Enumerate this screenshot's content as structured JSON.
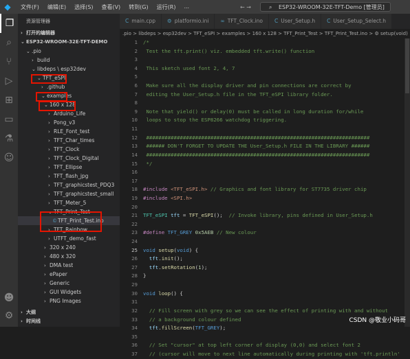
{
  "titlebar": {
    "menus": [
      "文件(F)",
      "编辑(E)",
      "选择(S)",
      "查看(V)",
      "转到(G)",
      "运行(R)",
      "..."
    ],
    "search_text": "ESP32-WROOM-32E-TFT-Demo [管理员]"
  },
  "sidebar": {
    "title": "资源管理器",
    "rows": [
      {
        "label": "打开的编辑器",
        "indent": 0,
        "chev": "›",
        "bold": true
      },
      {
        "label": "ESP32-WROOM-32E-TFT-DEMO",
        "indent": 0,
        "chev": "⌄",
        "bold": true
      },
      {
        "label": ".pio",
        "indent": 1,
        "chev": "⌄"
      },
      {
        "label": "build",
        "indent": 2,
        "chev": "›"
      },
      {
        "label": "libdeps \\ esp32dev",
        "indent": 2,
        "chev": "⌄"
      },
      {
        "label": "TFT_eSPI",
        "indent": 3,
        "chev": "⌄"
      },
      {
        "label": ".github",
        "indent": 4,
        "chev": "›"
      },
      {
        "label": "examples",
        "indent": 4,
        "chev": "⌄"
      },
      {
        "label": "160 x 128",
        "indent": 5,
        "chev": "⌄"
      },
      {
        "label": "Arduino_Life",
        "indent": 6,
        "chev": "›"
      },
      {
        "label": "Pong_v3",
        "indent": 6,
        "chev": "›"
      },
      {
        "label": "RLE_Font_test",
        "indent": 6,
        "chev": "›"
      },
      {
        "label": "TFT_Char_times",
        "indent": 6,
        "chev": "›"
      },
      {
        "label": "TFT_Clock",
        "indent": 6,
        "chev": "›"
      },
      {
        "label": "TFT_Clock_Digital",
        "indent": 6,
        "chev": "›"
      },
      {
        "label": "TFT_Ellipse",
        "indent": 6,
        "chev": "›"
      },
      {
        "label": "TFT_flash_jpg",
        "indent": 6,
        "chev": "›"
      },
      {
        "label": "TFT_graphicstest_PDQ3",
        "indent": 6,
        "chev": "›"
      },
      {
        "label": "TFT_graphicstest_small",
        "indent": 6,
        "chev": "›"
      },
      {
        "label": "TFT_Meter_5",
        "indent": 6,
        "chev": "›"
      },
      {
        "label": "TFT_Print_Test",
        "indent": 6,
        "chev": "⌄"
      },
      {
        "label": "TFT_Print_Test.ino",
        "indent": 7,
        "chev": "",
        "file": true,
        "selected": true
      },
      {
        "label": "TFT_Rainbow",
        "indent": 6,
        "chev": "›"
      },
      {
        "label": "UTFT_demo_fast",
        "indent": 6,
        "chev": "›"
      },
      {
        "label": "320 x 240",
        "indent": 5,
        "chev": "›"
      },
      {
        "label": "480 x 320",
        "indent": 5,
        "chev": "›"
      },
      {
        "label": "DMA test",
        "indent": 5,
        "chev": "›"
      },
      {
        "label": "ePaper",
        "indent": 5,
        "chev": "›"
      },
      {
        "label": "Generic",
        "indent": 5,
        "chev": "›"
      },
      {
        "label": "GUI Widgets",
        "indent": 5,
        "chev": "›"
      },
      {
        "label": "PNG Images",
        "indent": 5,
        "chev": "›"
      },
      {
        "label": "大纲",
        "indent": 0,
        "chev": "›",
        "bold": true
      },
      {
        "label": "时间线",
        "indent": 0,
        "chev": "›",
        "bold": true
      }
    ]
  },
  "tabs": [
    {
      "label": "main.cpp",
      "icon": "C"
    },
    {
      "label": "platformio.ini",
      "icon": "⚙"
    },
    {
      "label": "TFT_Clock.ino",
      "icon": "∞"
    },
    {
      "label": "User_Setup.h",
      "icon": "C"
    },
    {
      "label": "User_Setup_Select.h",
      "icon": "C"
    }
  ],
  "breadcrumb": ".pio > libdeps > esp32dev > TFT_eSPI > examples > 160 x 128 > TFT_Print_Test > TFT_Print_Test.ino > ⚙ setup(void)",
  "editor": {
    "lines": [
      {
        "n": "1",
        "html": "<span class='c-com'>/*</span>"
      },
      {
        "n": "2",
        "html": "<span class='c-com'> Test the tft.print() viz. embedded tft.write() function</span>"
      },
      {
        "n": "3",
        "html": ""
      },
      {
        "n": "4",
        "html": "<span class='c-com'> This sketch used font 2, 4, 7</span>"
      },
      {
        "n": "5",
        "html": ""
      },
      {
        "n": "6",
        "html": "<span class='c-com'> Make sure all the display driver and pin connections are correct by</span>"
      },
      {
        "n": "7",
        "html": "<span class='c-com'> editing the User_Setup.h file in the TFT_eSPI library folder.</span>"
      },
      {
        "n": "8",
        "html": ""
      },
      {
        "n": "9",
        "html": "<span class='c-com'> Note that yield() or delay(0) must be called in long duration for/while</span>"
      },
      {
        "n": "10",
        "html": "<span class='c-com'> loops to stop the ESP8266 watchdog triggering.</span>"
      },
      {
        "n": "11",
        "html": ""
      },
      {
        "n": "12",
        "html": "<span class='c-com'> #########################################################################</span>"
      },
      {
        "n": "13",
        "html": "<span class='c-com'> ###### DON'T FORGET TO UPDATE THE User_Setup.h FILE IN THE LIBRARY ######</span>"
      },
      {
        "n": "14",
        "html": "<span class='c-com'> #########################################################################</span>"
      },
      {
        "n": "15",
        "html": "<span class='c-com'> */</span>"
      },
      {
        "n": "16",
        "html": ""
      },
      {
        "n": "17",
        "html": ""
      },
      {
        "n": "18",
        "html": "<span class='c-pp'>#include</span> <span class='c-str'>&lt;TFT_eSPI.h&gt;</span> <span class='c-com'>// Graphics and font library for ST7735 driver chip</span>"
      },
      {
        "n": "19",
        "html": "<span class='c-pp'>#include</span> <span class='c-str'>&lt;SPI.h&gt;</span>"
      },
      {
        "n": "20",
        "html": ""
      },
      {
        "n": "21",
        "html": "<span class='c-ty'>TFT_eSPI</span> <span class='c-var'>tft</span> = <span class='c-fn'>TFT_eSPI</span>();  <span class='c-com'>// Invoke library, pins defined in User_Setup.h</span>"
      },
      {
        "n": "22",
        "html": ""
      },
      {
        "n": "23",
        "html": "<span class='c-pp'>#define</span> <span class='c-def'>TFT_GREY</span> <span class='c-num'>0x5AEB</span> <span class='c-com'>// New colour</span>"
      },
      {
        "n": "24",
        "html": ""
      },
      {
        "n": "25",
        "html": "<span class='c-kw'>void</span> <span class='c-fn'>setup</span>(<span class='c-kw'>void</span>) {"
      },
      {
        "n": "26",
        "html": "  <span class='c-var'>tft</span>.<span class='c-fn'>init</span>();"
      },
      {
        "n": "27",
        "html": "  <span class='c-var'>tft</span>.<span class='c-fn'>setRotation</span>(<span class='c-num'>1</span>);"
      },
      {
        "n": "28",
        "html": "}"
      },
      {
        "n": "29",
        "html": ""
      },
      {
        "n": "30",
        "html": "<span class='c-kw'>void</span> <span class='c-fn'>loop</span>() {"
      },
      {
        "n": "31",
        "html": ""
      },
      {
        "n": "32",
        "html": "  <span class='c-com'>// Fill screen with grey so we can see the effect of printing with and without</span>"
      },
      {
        "n": "33",
        "html": "  <span class='c-com'>// a background colour defined</span>"
      },
      {
        "n": "34",
        "html": "  <span class='c-var'>tft</span>.<span class='c-fn'>fillScreen</span>(<span class='c-def'>TFT_GREY</span>);"
      },
      {
        "n": "35",
        "html": ""
      },
      {
        "n": "36",
        "html": "  <span class='c-com'>// Set \"cursor\" at top left corner of display (0,0) and select font 2</span>"
      },
      {
        "n": "37",
        "html": "  <span class='c-com'>// (cursor will move to next line automatically during printing with 'tft.println'</span>"
      }
    ]
  },
  "watermark": "CSDN @敬业小码哥"
}
